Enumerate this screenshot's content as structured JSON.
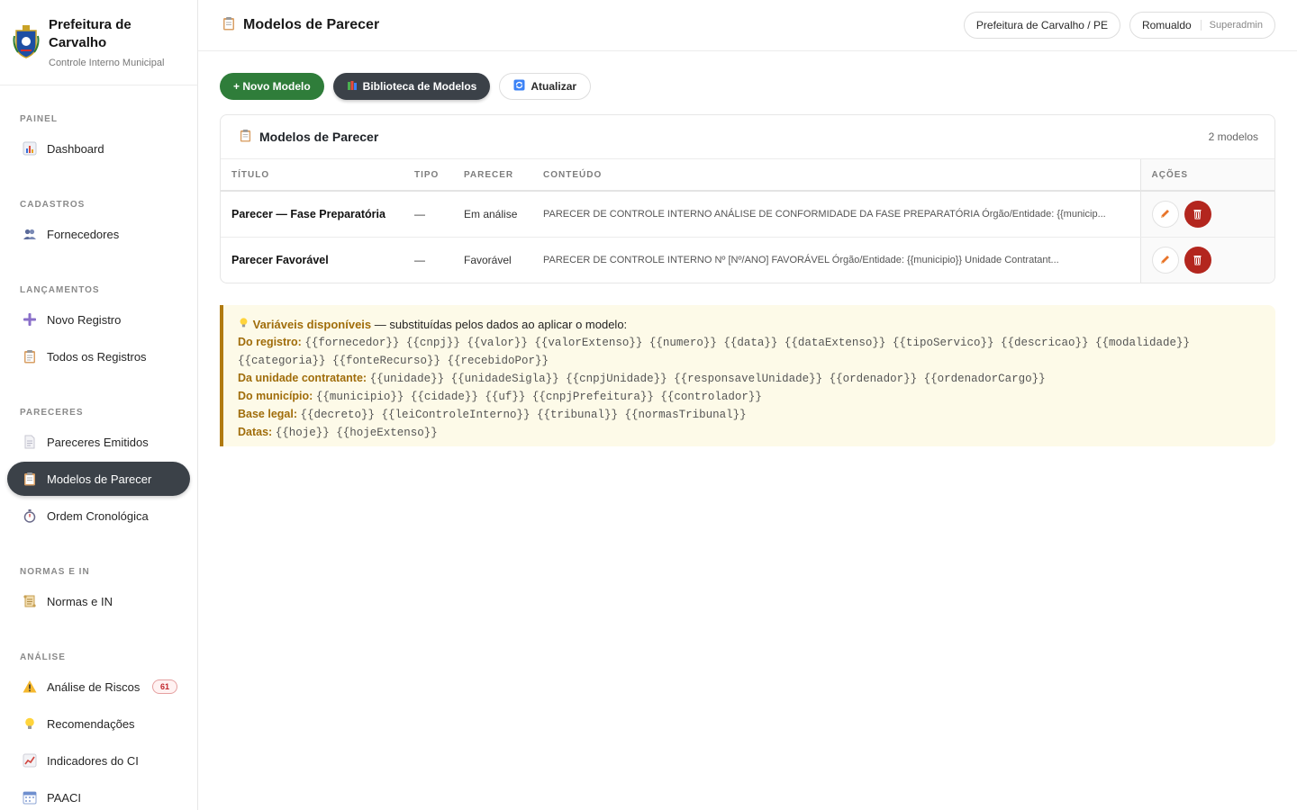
{
  "brand": {
    "name": "Prefeitura de Carvalho",
    "subtitle": "Controle Interno Municipal"
  },
  "sidebar": {
    "sections": [
      {
        "label": "PAINEL",
        "items": [
          {
            "label": "Dashboard",
            "icon": "bar-chart-icon"
          }
        ]
      },
      {
        "label": "CADASTROS",
        "items": [
          {
            "label": "Fornecedores",
            "icon": "users-icon"
          }
        ]
      },
      {
        "label": "LANÇAMENTOS",
        "items": [
          {
            "label": "Novo Registro",
            "icon": "plus-icon"
          },
          {
            "label": "Todos os Registros",
            "icon": "clipboard-icon"
          }
        ]
      },
      {
        "label": "PARECERES",
        "items": [
          {
            "label": "Pareceres Emitidos",
            "icon": "document-icon"
          },
          {
            "label": "Modelos de Parecer",
            "icon": "clipboard-icon",
            "active": true
          },
          {
            "label": "Ordem Cronológica",
            "icon": "stopwatch-icon"
          }
        ]
      },
      {
        "label": "NORMAS E IN",
        "items": [
          {
            "label": "Normas e IN",
            "icon": "scroll-icon"
          }
        ]
      },
      {
        "label": "ANÁLISE",
        "items": [
          {
            "label": "Análise de Riscos",
            "icon": "warning-icon",
            "badge": "61"
          },
          {
            "label": "Recomendações",
            "icon": "lightbulb-icon"
          },
          {
            "label": "Indicadores do CI",
            "icon": "trend-icon"
          },
          {
            "label": "PAACI",
            "icon": "calendar-icon"
          }
        ]
      }
    ]
  },
  "header": {
    "title": "Modelos de Parecer",
    "org": "Prefeitura de Carvalho / PE",
    "user": "Romualdo",
    "role": "Superadmin"
  },
  "toolbar": {
    "new_label": "+ Novo Modelo",
    "library_label": "Biblioteca de Modelos",
    "refresh_label": "Atualizar"
  },
  "table": {
    "title": "Modelos de Parecer",
    "count": "2 modelos",
    "columns": [
      "TÍTULO",
      "TIPO",
      "PARECER",
      "CONTEÚDO",
      "AÇÕES"
    ],
    "rows": [
      {
        "titulo": "Parecer — Fase Preparatória",
        "tipo": "—",
        "parecer": "Em análise",
        "conteudo": "PARECER DE CONTROLE INTERNO ANÁLISE DE CONFORMIDADE DA FASE PREPARATÓRIA Órgão/Entidade: {{municip..."
      },
      {
        "titulo": "Parecer Favorável",
        "tipo": "—",
        "parecer": "Favorável",
        "conteudo": "PARECER DE CONTROLE INTERNO Nº [Nº/ANO] FAVORÁVEL Órgão/Entidade: {{municipio}} Unidade Contratant..."
      }
    ]
  },
  "variables": {
    "heading_highlight": "Variáveis disponíveis",
    "heading_rest": " — substituídas pelos dados ao aplicar o modelo:",
    "groups": [
      {
        "label": "Do registro:",
        "vars": "{{fornecedor}} {{cnpj}} {{valor}} {{valorExtenso}} {{numero}} {{data}} {{dataExtenso}} {{tipoServico}} {{descricao}} {{modalidade}}",
        "vars2": "{{categoria}} {{fonteRecurso}} {{recebidoPor}}"
      },
      {
        "label": "Da unidade contratante:",
        "vars": "{{unidade}} {{unidadeSigla}} {{cnpjUnidade}} {{responsavelUnidade}} {{ordenador}} {{ordenadorCargo}}"
      },
      {
        "label": "Do município:",
        "vars": "{{municipio}} {{cidade}} {{uf}} {{cnpjPrefeitura}} {{controlador}}"
      },
      {
        "label": "Base legal:",
        "vars": "{{decreto}} {{leiControleInterno}} {{tribunal}} {{normasTribunal}}"
      },
      {
        "label": "Datas:",
        "vars": "{{hoje}} {{hojeExtenso}}"
      }
    ]
  },
  "colors": {
    "active_nav": "#3b4148",
    "primary_green": "#2f7d3a",
    "danger": "#b3261e",
    "vars_accent": "#a06d0b",
    "vars_bg": "#fdfae8"
  }
}
